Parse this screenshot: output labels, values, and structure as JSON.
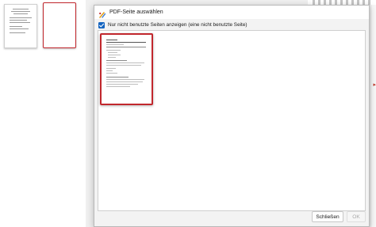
{
  "dialog": {
    "title": "PDF-Seite auswählen",
    "checkbox": {
      "label": "Nur nicht benutzte Seiten anzeigen (eine nicht benutzte Seite)",
      "checked": true
    },
    "buttons": {
      "close": "Schließen",
      "ok": "OK",
      "ok_enabled": false
    }
  },
  "icons": {
    "app": "app-logo-icon",
    "checkmark": "checkmark-icon",
    "expand_arrow": "chevron-right-icon"
  },
  "colors": {
    "accent": "#1565c0",
    "selection": "#c1272d",
    "dialog_background": "#f3f3f3",
    "workspace_background": "#f0f0f0"
  }
}
